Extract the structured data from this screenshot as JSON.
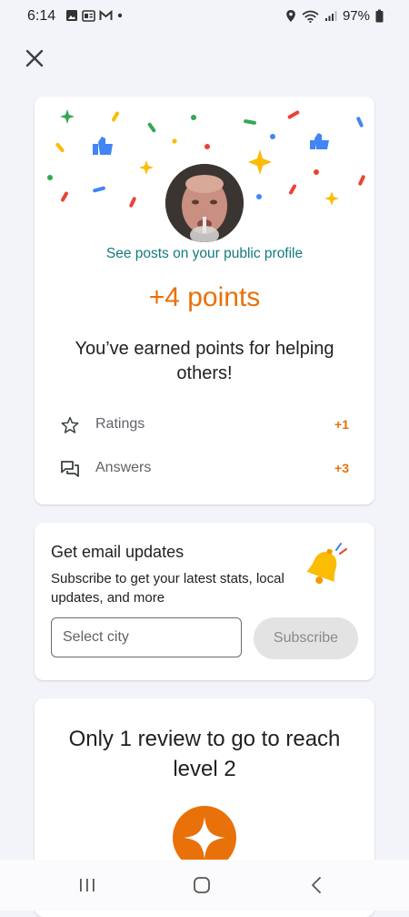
{
  "status_bar": {
    "time": "6:14",
    "battery": "97%",
    "left_icons": [
      "image-icon",
      "news-icon",
      "gmail-icon",
      "dot-icon"
    ],
    "right_icons": [
      "location-icon",
      "wifi-icon",
      "signal-icon",
      "battery-icon"
    ]
  },
  "header": {
    "close_icon": "close-icon"
  },
  "points_card": {
    "profile_link": "See posts on your public profile",
    "points": "+4 points",
    "message": "You’ve earned points for helping others!",
    "stats": [
      {
        "label": "Ratings",
        "value": "+1",
        "icon": "star-outline-icon"
      },
      {
        "label": "Answers",
        "value": "+3",
        "icon": "qa-icon"
      }
    ]
  },
  "email_card": {
    "title": "Get email updates",
    "description": "Subscribe to get your latest stats, local updates, and more",
    "city_placeholder": "Select city",
    "subscribe_label": "Subscribe",
    "icon": "bell-icon"
  },
  "level_card": {
    "title": "Only 1 review to go to reach level 2",
    "badge_icon": "local-guide-badge-icon"
  },
  "nav_bar": {
    "icons": [
      "recent-apps-icon",
      "home-icon",
      "back-icon"
    ]
  },
  "colors": {
    "accent_orange": "#e8710a",
    "link_teal": "#137a7f",
    "background": "#f3f4f9",
    "button_disabled": "#e3e3e3"
  }
}
